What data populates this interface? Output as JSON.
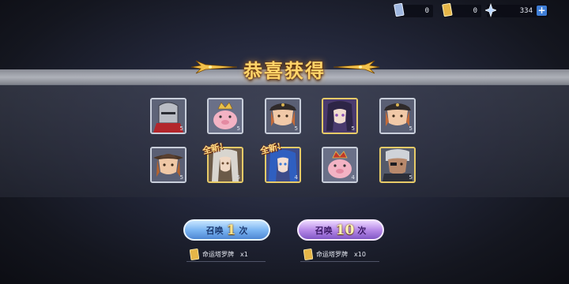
{
  "currencies": [
    {
      "icon": "tarot-card-icon",
      "value": "0"
    },
    {
      "icon": "gold-ticket-icon",
      "value": "0"
    },
    {
      "icon": "star-crystal-icon",
      "value": "334"
    }
  ],
  "plus_label": "+",
  "title": "恭喜获得",
  "cards": [
    {
      "name": "helmet-knight",
      "rank": "5",
      "tier": "silver"
    },
    {
      "name": "king-pig",
      "rank": "5",
      "tier": "silver"
    },
    {
      "name": "cap-soldier",
      "rank": "5",
      "tier": "silver"
    },
    {
      "name": "dark-hair-girl",
      "rank": "5",
      "tier": "gold"
    },
    {
      "name": "cap-soldier",
      "rank": "5",
      "tier": "silver"
    },
    {
      "name": "cowboy-hero",
      "rank": "5",
      "tier": "silver"
    },
    {
      "name": "silver-hair-mage",
      "rank": "5",
      "tier": "gold",
      "new": "全新!"
    },
    {
      "name": "blue-hair-girl",
      "rank": "4",
      "tier": "gold",
      "new": "全新!"
    },
    {
      "name": "king-pig",
      "rank": "4",
      "tier": "silver"
    },
    {
      "name": "eyepatch-warrior",
      "rank": "5",
      "tier": "gold"
    }
  ],
  "summon_one": {
    "prefix": "召唤",
    "count": "1",
    "suffix": "次",
    "cost_name": "命运塔罗牌",
    "cost_qty": "x1"
  },
  "summon_ten": {
    "prefix": "召唤",
    "count": "10",
    "suffix": "次",
    "cost_name": "命运塔罗牌",
    "cost_qty": "x10"
  },
  "colors": {
    "gold_title": "#ffd46a",
    "blue_button": "#7cb6f2",
    "purple_button": "#b88ae8"
  }
}
